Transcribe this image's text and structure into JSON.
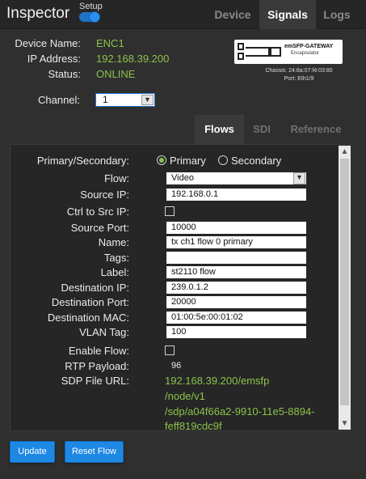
{
  "app": {
    "title": "Inspector",
    "setup_label": "Setup"
  },
  "top_tabs": [
    {
      "label": "Device"
    },
    {
      "label": "Signals"
    },
    {
      "label": "Logs"
    }
  ],
  "device": {
    "name_label": "Device Name:",
    "name_value": "ENC1",
    "ip_label": "IP Address:",
    "ip_value": "192.168.39.200",
    "status_label": "Status:",
    "status_value": "ONLINE",
    "image_name": "emSFP-GATEWAY",
    "image_sub": "Encapsulator",
    "chassis": "Chassis: 24:8a:07:f4:03:80",
    "port": "Port: Eth1/9"
  },
  "channel": {
    "label": "Channel:",
    "value": "1"
  },
  "sub_tabs": [
    {
      "label": "Flows"
    },
    {
      "label": "SDI"
    },
    {
      "label": "Reference"
    }
  ],
  "form": {
    "primary_secondary_label": "Primary/Secondary:",
    "primary_option": "Primary",
    "secondary_option": "Secondary",
    "flow_label": "Flow:",
    "flow_value": "Video",
    "source_ip_label": "Source IP:",
    "source_ip_value": "192.168.0.1",
    "ctrl_label": "Ctrl to Src IP:",
    "source_port_label": "Source Port:",
    "source_port_value": "10000",
    "name_label": "Name:",
    "name_value": "tx ch1 flow 0 primary",
    "tags_label": "Tags:",
    "tags_value": "",
    "label_label": "Label:",
    "label_value": "st2110 flow",
    "dest_ip_label": "Destination IP:",
    "dest_ip_value": "239.0.1.2",
    "dest_port_label": "Destination Port:",
    "dest_port_value": "20000",
    "dest_mac_label": "Destination MAC:",
    "dest_mac_value": "01:00:5e:00:01:02",
    "vlan_label": "VLAN Tag:",
    "vlan_value": "100",
    "enable_label": "Enable Flow:",
    "rtp_label": "RTP Payload:",
    "rtp_value": "96",
    "sdp_label": "SDP File URL:",
    "sdp_lines": [
      "192.168.39.200/emsfp",
      "/node/v1",
      "/sdp/a04f66a2-9910-11e5-8894-",
      "feff819cdc9f"
    ]
  },
  "buttons": {
    "update": "Update",
    "reset": "Reset Flow"
  },
  "colors": {
    "accent": "#1e88e5",
    "status_green": "#8bc34a",
    "background": "#2f2f2f"
  }
}
